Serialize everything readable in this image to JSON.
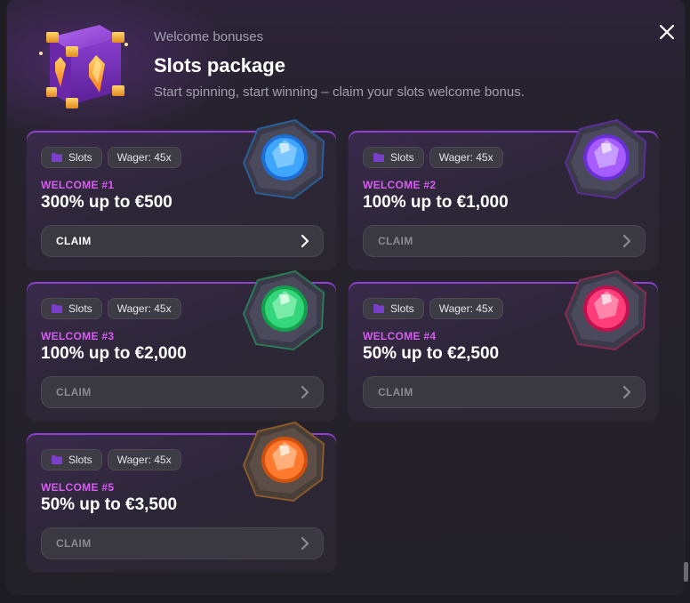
{
  "header": {
    "eyebrow": "Welcome bonuses",
    "title": "Slots package",
    "subtitle": "Start spinning, start winning – claim your slots welcome bonus.",
    "icon": "treasure-chest-icon"
  },
  "close": {
    "icon": "close-icon"
  },
  "cards": [
    {
      "category": "Slots",
      "wager": "Wager: 45x",
      "label": "WELCOME #1",
      "amount": "300% up to €500",
      "claim": "CLAIM",
      "gem_color": "#3ea6ff",
      "state": "active"
    },
    {
      "category": "Slots",
      "wager": "Wager: 45x",
      "label": "WELCOME #2",
      "amount": "100% up to €1,000",
      "claim": "CLAIM",
      "gem_color": "#a65cff",
      "state": "locked"
    },
    {
      "category": "Slots",
      "wager": "Wager: 45x",
      "label": "WELCOME #3",
      "amount": "100% up to €2,000",
      "claim": "CLAIM",
      "gem_color": "#33d67a",
      "state": "locked"
    },
    {
      "category": "Slots",
      "wager": "Wager: 45x",
      "label": "WELCOME #4",
      "amount": "50% up to €2,500",
      "claim": "CLAIM",
      "gem_color": "#ff3d7a",
      "state": "locked"
    },
    {
      "category": "Slots",
      "wager": "Wager: 45x",
      "label": "WELCOME #5",
      "amount": "50% up to €3,500",
      "claim": "CLAIM",
      "gem_color": "#ff7a2e",
      "state": "locked"
    }
  ],
  "colors": {
    "accent": "#d75df0",
    "card_top_border": "#8f3fd6",
    "background": "#232128"
  }
}
